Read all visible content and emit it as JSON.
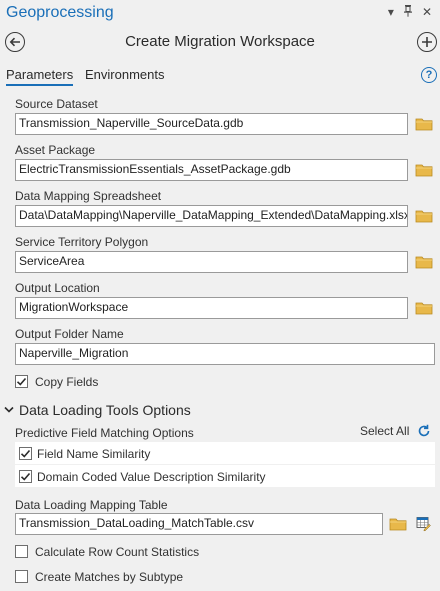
{
  "pane": {
    "title": "Geoprocessing",
    "menu_glyph": "▾",
    "pin_glyph": "📌",
    "close_glyph": "✕"
  },
  "tool": {
    "back_icon": "arrow-left-icon",
    "title": "Create Migration Workspace",
    "add_icon": "plus-icon"
  },
  "tabs": [
    {
      "label": "Parameters",
      "active": true
    },
    {
      "label": "Environments",
      "active": false
    }
  ],
  "help_label": "?",
  "params": {
    "source_dataset": {
      "label": "Source Dataset",
      "value": "Transmission_Naperville_SourceData.gdb"
    },
    "asset_package": {
      "label": "Asset Package",
      "value": "ElectricTransmissionEssentials_AssetPackage.gdb"
    },
    "data_mapping": {
      "label": "Data Mapping Spreadsheet",
      "value": "Data\\DataMapping\\Naperville_DataMapping_Extended\\DataMapping.xlsx"
    },
    "service_territory": {
      "label": "Service Territory Polygon",
      "value": "ServiceArea"
    },
    "output_location": {
      "label": "Output Location",
      "value": "MigrationWorkspace"
    },
    "output_folder": {
      "label": "Output Folder Name",
      "value": "Naperville_Migration"
    },
    "copy_fields": {
      "label": "Copy Fields",
      "checked": true
    }
  },
  "data_loading": {
    "section_title": "Data Loading Tools Options",
    "expanded": true,
    "predictive_label": "Predictive Field Matching Options",
    "select_all_label": "Select All",
    "options": [
      {
        "label": "Field Name Similarity",
        "checked": true
      },
      {
        "label": "Domain Coded Value Description Similarity",
        "checked": true
      }
    ],
    "mapping_table": {
      "label": "Data Loading Mapping Table",
      "value": "Transmission_DataLoading_MatchTable.csv"
    },
    "row_count": {
      "label": "Calculate Row Count Statistics",
      "checked": false
    },
    "by_subtype": {
      "label": "Create Matches by Subtype",
      "checked": false
    }
  },
  "colors": {
    "accent": "#1a6fb8",
    "folder": "#e8b84a",
    "background": "#f0f0f0"
  }
}
